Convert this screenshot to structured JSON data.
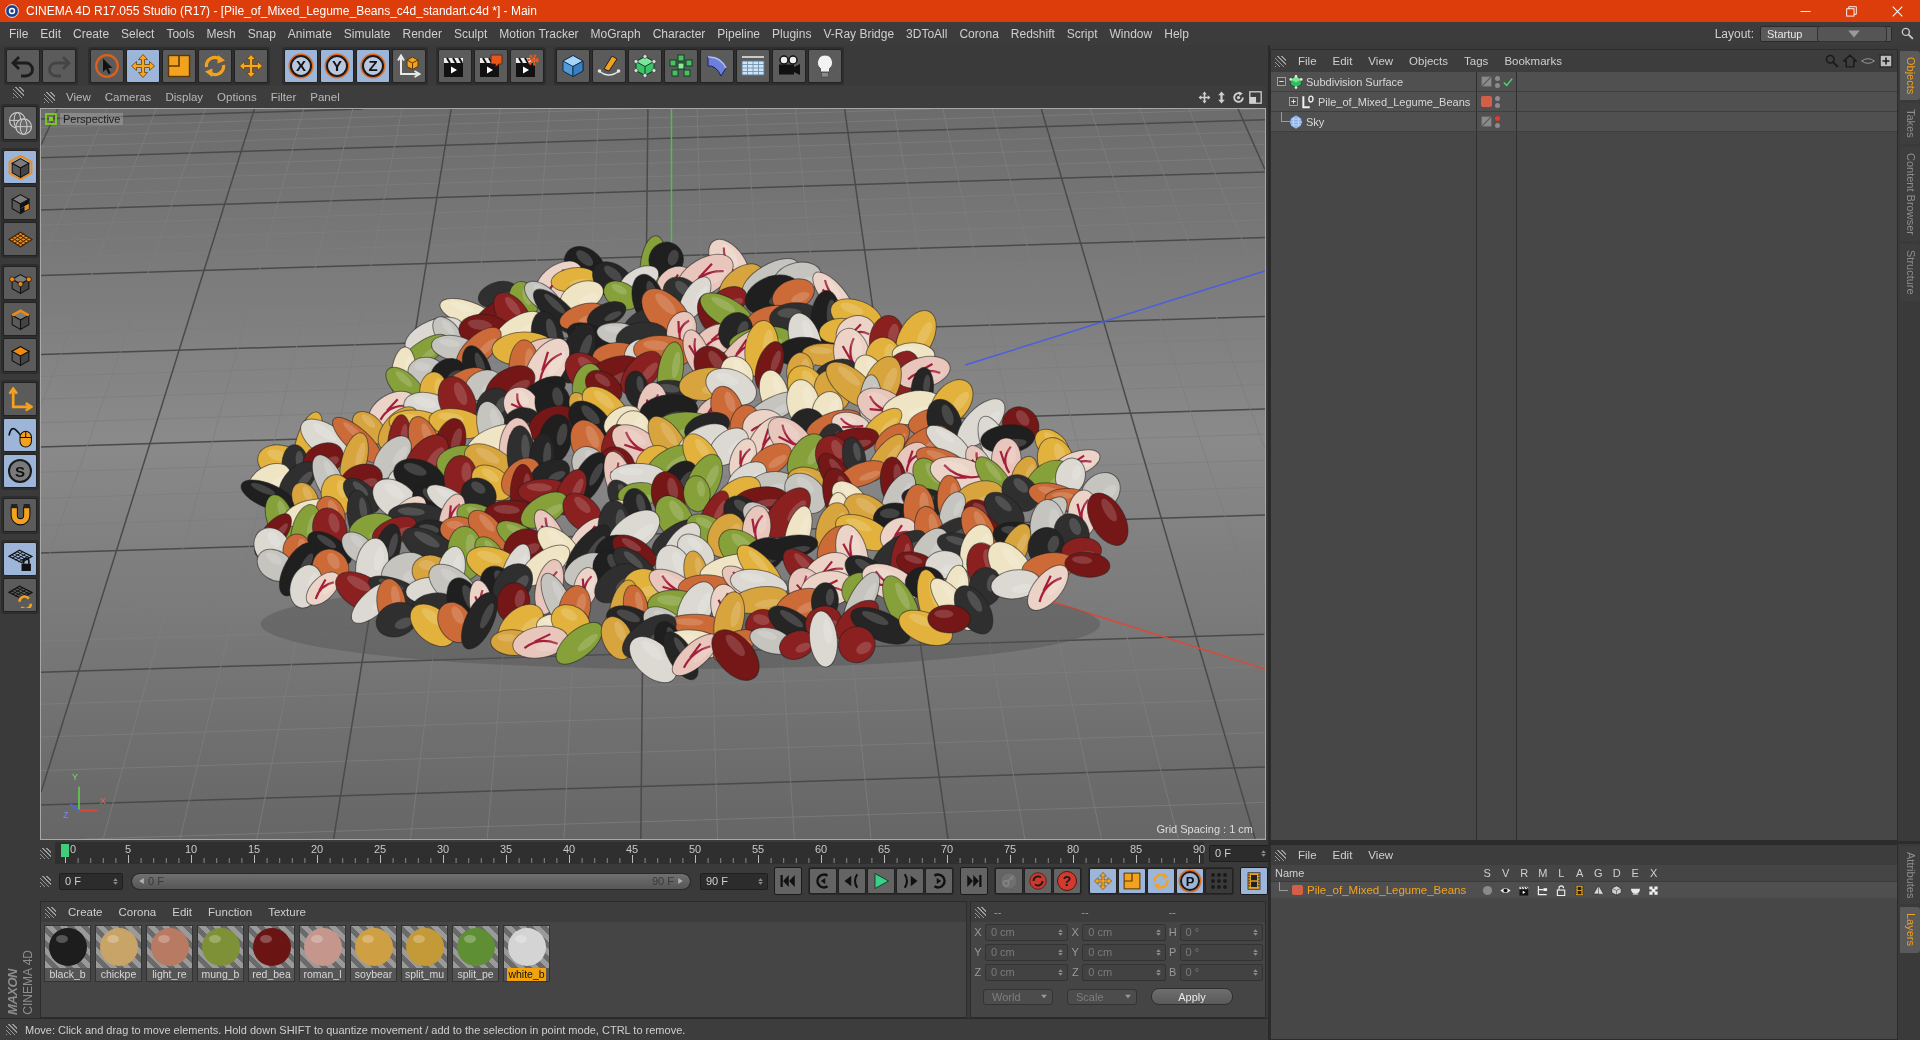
{
  "window": {
    "title": "CINEMA 4D R17.055 Studio (R17) - [Pile_of_Mixed_Legume_Beans_c4d_standart.c4d *] - Main"
  },
  "menu_bar": {
    "items": [
      "File",
      "Edit",
      "Create",
      "Select",
      "Tools",
      "Mesh",
      "Snap",
      "Animate",
      "Simulate",
      "Render",
      "Sculpt",
      "Motion Tracker",
      "MoGraph",
      "Character",
      "Pipeline",
      "Plugins",
      "V-Ray Bridge",
      "3DToAll",
      "Corona",
      "Redshift",
      "Script",
      "Window",
      "Help"
    ],
    "layout_label": "Layout:",
    "layout_value": "Startup"
  },
  "toolbar": {
    "history": [
      {
        "disabled": false
      },
      {
        "disabled": true
      }
    ],
    "tools": [
      {
        "selected": false
      },
      {
        "selected": true
      },
      {
        "selected": false
      },
      {
        "selected": false
      },
      {
        "selected": false
      }
    ],
    "axes": [
      {
        "label": "X",
        "selected": true
      },
      {
        "label": "Y",
        "selected": true
      },
      {
        "label": "Z",
        "selected": true
      }
    ]
  },
  "objects": {
    "menu": [
      "File",
      "Edit",
      "View",
      "Objects",
      "Tags",
      "Bookmarks"
    ],
    "tree": [
      {
        "name": "Subdivision Surface",
        "kind": "subdivision",
        "expanded": true,
        "editor_hidden": false,
        "render_hidden": false,
        "enabled": true,
        "children": [
          {
            "name": "Pile_of_Mixed_Legume_Beans",
            "kind": "null",
            "expanded": false,
            "color": "#d35f49",
            "editor_hidden": false,
            "render_hidden": false
          }
        ]
      },
      {
        "name": "Sky",
        "kind": "sky",
        "editor_hidden": true,
        "render_hidden": false
      }
    ]
  },
  "side_tabs": {
    "top": [
      {
        "label": "Objects",
        "selected": true
      },
      {
        "label": "Takes",
        "selected": false
      },
      {
        "label": "Content Browser",
        "selected": false
      },
      {
        "label": "Structure",
        "selected": false
      }
    ],
    "bottom": [
      {
        "label": "Attributes",
        "selected": false
      },
      {
        "label": "Layers",
        "selected": true
      }
    ]
  },
  "mode_toolbar": [
    {
      "selected": false
    },
    {
      "selected": true
    },
    {
      "selected": false
    },
    {
      "selected": false
    },
    {
      "selected": false
    },
    {
      "selected": false
    },
    {
      "selected": false
    },
    {
      "selected": false
    },
    {
      "selected": true
    },
    {
      "selected": true,
      "label": "S"
    },
    {
      "selected": false
    },
    {
      "selected": true
    },
    {
      "selected": false
    }
  ],
  "viewport": {
    "menu": [
      "View",
      "Cameras",
      "Display",
      "Options",
      "Filter",
      "Panel"
    ],
    "camera": "Perspective",
    "axis_labels": [
      "Y",
      "X",
      "Z"
    ],
    "grid_spacing": "Grid Spacing : 1 cm"
  },
  "timeline": {
    "labels": [
      "0",
      "5",
      "10",
      "15",
      "20",
      "25",
      "30",
      "35",
      "40",
      "45",
      "50",
      "55",
      "60",
      "65",
      "70",
      "75",
      "80",
      "85",
      "90"
    ],
    "level": 0,
    "current_frame": "0 F",
    "start_frame": "0 F",
    "range": {
      "start": "0 F",
      "end": "90 F",
      "level": 1
    },
    "end_frame": "90 F",
    "record_tools": [
      {
        "disabled": true
      },
      {
        "disabled": false
      },
      {
        "disabled": false,
        "label": "?"
      }
    ],
    "key_tools": [
      {
        "selected": true
      },
      {
        "selected": true
      },
      {
        "selected": true
      },
      {
        "selected": true,
        "label": "P"
      },
      {
        "selected": false
      }
    ],
    "timeline_button": {
      "selected": true
    }
  },
  "layers": {
    "menu": [
      "File",
      "Edit",
      "View"
    ],
    "columns": [
      "Name",
      "S",
      "V",
      "R",
      "M",
      "L",
      "A",
      "G",
      "D",
      "E",
      "X"
    ],
    "rows": [
      {
        "name": "Pile_of_Mixed_Legume_Beans",
        "color": "#d35f49",
        "selected": true
      }
    ]
  },
  "materials": {
    "menu": [
      "Create",
      "Corona",
      "Edit",
      "Function",
      "Texture"
    ],
    "items": [
      {
        "name": "black_b",
        "color": "#1d1d1d",
        "selected": false
      },
      {
        "name": "chickpe",
        "color": "#c9a468",
        "selected": false
      },
      {
        "name": "light_re",
        "color": "#b87a62",
        "selected": false
      },
      {
        "name": "mung_b",
        "color": "#7f9136",
        "selected": false
      },
      {
        "name": "red_bea",
        "color": "#6a1414",
        "selected": false
      },
      {
        "name": "roman_l",
        "color": "#c4968c",
        "selected": false
      },
      {
        "name": "soybear",
        "color": "#cf9f44",
        "selected": false
      },
      {
        "name": "split_mu",
        "color": "#c49a38",
        "selected": false
      },
      {
        "name": "split_pe",
        "color": "#5f8f34",
        "selected": false
      },
      {
        "name": "white_b",
        "color": "#d4d4d4",
        "selected": true
      }
    ]
  },
  "coordinates": {
    "disabled": true,
    "headers": [
      "--",
      "--",
      "--"
    ],
    "rows": [
      {
        "axis": "X",
        "position": "0 cm",
        "size_axis": "X",
        "size": "0 cm",
        "rotation_axis": "H",
        "rotation": "0 °"
      },
      {
        "axis": "Y",
        "position": "0 cm",
        "size_axis": "Y",
        "size": "0 cm",
        "rotation_axis": "P",
        "rotation": "0 °"
      },
      {
        "axis": "Z",
        "position": "0 cm",
        "size_axis": "Z",
        "size": "0 cm",
        "rotation_axis": "B",
        "rotation": "0 °"
      }
    ],
    "mode": "World",
    "transform": "Scale",
    "apply": "Apply"
  },
  "branding": {
    "company": "MAXON",
    "product": "CINEMA 4D"
  },
  "status_bar": {
    "text": "Move: Click and drag to move elements. Hold down SHIFT to quantize movement / add to the selection in point mode, CTRL to remove."
  }
}
